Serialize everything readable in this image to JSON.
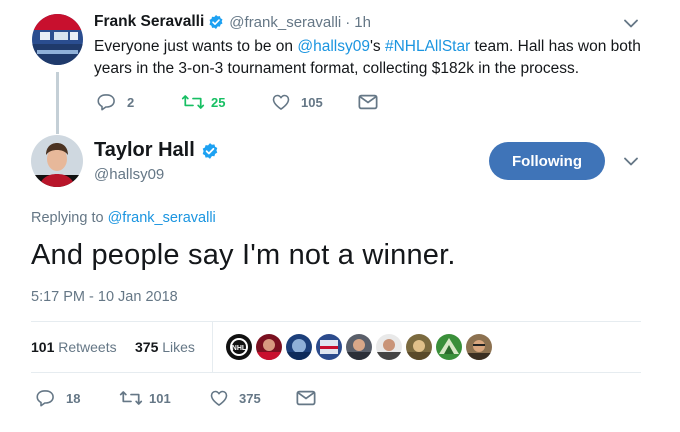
{
  "colors": {
    "link": "#1b95e0",
    "follow_button": "#3f74b8",
    "muted": "#657786",
    "retweet_green": "#17bf63"
  },
  "parent_tweet": {
    "name": "Frank Seravalli",
    "handle": "@frank_seravalli",
    "separator": "·",
    "time": "1h",
    "text_parts": {
      "p1": "Everyone just wants to be on ",
      "mention": "@hallsy09",
      "p2": "'s ",
      "hashtag": "#NHLAllStar",
      "p3": " team. Hall has won both years in the 3-on-3 tournament format, collecting $182k in the process."
    },
    "replies": "2",
    "retweets": "25",
    "likes": "105",
    "icons": [
      "reply-icon",
      "retweet-icon",
      "heart-icon",
      "message-icon",
      "verified-icon",
      "chevron-down-icon"
    ]
  },
  "main_tweet": {
    "name": "Taylor Hall",
    "handle": "@hallsy09",
    "follow_label": "Following",
    "replying_label": "Replying to",
    "replying_handle": "@frank_seravalli",
    "text": "And people say I'm not a winner.",
    "timestamp": "5:17 PM - 10 Jan 2018",
    "retweets_count": "101",
    "retweets_label": "Retweets",
    "likes_count": "375",
    "likes_label": "Likes",
    "liker_count": 9,
    "replies": "18",
    "retweets": "101",
    "likes": "375"
  }
}
